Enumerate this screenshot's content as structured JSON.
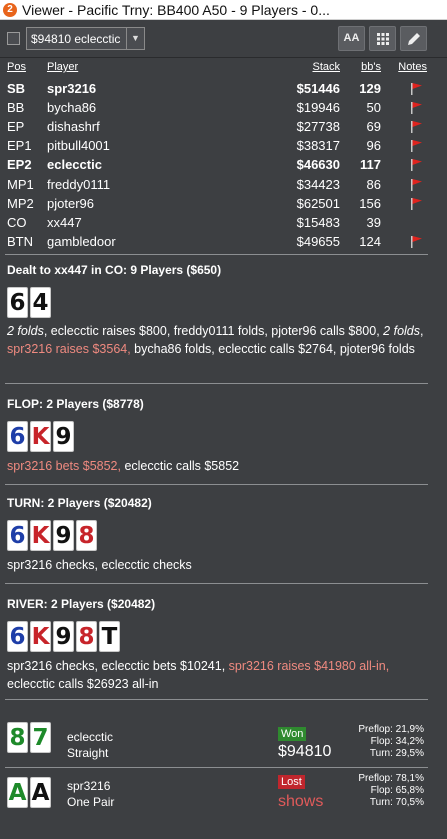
{
  "window": {
    "title": "Viewer - Pacific Trny: BB400 A50 - 9 Players - 0...",
    "app_icon_glyph": "2"
  },
  "toolbar": {
    "player_selected": "$94810 eclecctic",
    "font_button": "AA",
    "grid_button": "grid-icon",
    "edit_button": "pencil-icon"
  },
  "seats": {
    "headers": {
      "pos": "Pos",
      "player": "Player",
      "stack": "Stack",
      "bbs": "bb's",
      "notes": "Notes"
    },
    "rows": [
      {
        "pos": "SB",
        "player": "spr3216",
        "stack": "$51446",
        "bbs": "129",
        "flag": true,
        "bold": true
      },
      {
        "pos": "BB",
        "player": "bycha86",
        "stack": "$19946",
        "bbs": "50",
        "flag": true,
        "bold": false
      },
      {
        "pos": "EP",
        "player": "dishashrf",
        "stack": "$27738",
        "bbs": "69",
        "flag": true,
        "bold": false
      },
      {
        "pos": "EP1",
        "player": "pitbull4001",
        "stack": "$38317",
        "bbs": "96",
        "flag": true,
        "bold": false
      },
      {
        "pos": "EP2",
        "player": "eclecctic",
        "stack": "$46630",
        "bbs": "117",
        "flag": true,
        "bold": true
      },
      {
        "pos": "MP1",
        "player": "freddy0111",
        "stack": "$34423",
        "bbs": "86",
        "flag": true,
        "bold": false
      },
      {
        "pos": "MP2",
        "player": "pjoter96",
        "stack": "$62501",
        "bbs": "156",
        "flag": true,
        "bold": false
      },
      {
        "pos": "CO",
        "player": "xx447",
        "stack": "$15483",
        "bbs": "39",
        "flag": false,
        "bold": false
      },
      {
        "pos": "BTN",
        "player": "gambledoor",
        "stack": "$49655",
        "bbs": "124",
        "flag": true,
        "bold": false
      }
    ]
  },
  "preflop": {
    "heading": "Dealt to xx447 in CO: 9 Players ($650)",
    "cards": [
      {
        "rank": "6",
        "suit": "s"
      },
      {
        "rank": "4",
        "suit": "s"
      }
    ],
    "actions": [
      {
        "text": "2 folds",
        "style": "it"
      },
      {
        "text": ", eclecctic raises $800, freddy0111 folds, pjoter96 calls $800, ",
        "style": ""
      },
      {
        "text": "2 folds",
        "style": "it"
      },
      {
        "text": ", ",
        "style": ""
      },
      {
        "text": "spr3216 raises $3564,",
        "style": "hl"
      },
      {
        "text": " bycha86 folds, eclecctic calls $2764, pjoter96 folds",
        "style": ""
      }
    ]
  },
  "flop": {
    "heading": "FLOP: 2 Players ($8778)",
    "cards": [
      {
        "rank": "6",
        "suit": "d"
      },
      {
        "rank": "K",
        "suit": "h"
      },
      {
        "rank": "9",
        "suit": "s"
      }
    ],
    "actions": [
      {
        "text": "spr3216 bets $5852,",
        "style": "hl"
      },
      {
        "text": " eclecctic calls $5852",
        "style": ""
      }
    ]
  },
  "turn": {
    "heading": "TURN: 2 Players ($20482)",
    "cards": [
      {
        "rank": "6",
        "suit": "d"
      },
      {
        "rank": "K",
        "suit": "h"
      },
      {
        "rank": "9",
        "suit": "s"
      },
      {
        "rank": "8",
        "suit": "h"
      }
    ],
    "actions": [
      {
        "text": "spr3216 checks, eclecctic checks",
        "style": ""
      }
    ]
  },
  "river": {
    "heading": "RIVER: 2 Players ($20482)",
    "cards": [
      {
        "rank": "6",
        "suit": "d"
      },
      {
        "rank": "K",
        "suit": "h"
      },
      {
        "rank": "9",
        "suit": "s"
      },
      {
        "rank": "8",
        "suit": "h"
      },
      {
        "rank": "T",
        "suit": "s"
      }
    ],
    "actions": [
      {
        "text": "spr3216 checks, eclecctic bets $10241, ",
        "style": ""
      },
      {
        "text": "spr3216 raises $41980 all-in,",
        "style": "hl"
      },
      {
        "text": " eclecctic calls $26923 all-in",
        "style": ""
      }
    ]
  },
  "results": [
    {
      "player": "eclecctic",
      "hand": "Straight",
      "cards": [
        {
          "rank": "8",
          "suit": "c"
        },
        {
          "rank": "7",
          "suit": "c"
        }
      ],
      "badge": "Won",
      "badge_color": "#2f8a2f",
      "amount": "$94810",
      "amount_color": "#ffffff",
      "equity": {
        "preflop_label": "Preflop:",
        "preflop": "21,9%",
        "flop_label": "Flop:",
        "flop": "34,2%",
        "turn_label": "Turn:",
        "turn": "29,5%"
      }
    },
    {
      "player": "spr3216",
      "hand": "One Pair",
      "cards": [
        {
          "rank": "A",
          "suit": "c"
        },
        {
          "rank": "A",
          "suit": "s"
        }
      ],
      "badge": "Lost",
      "badge_color": "#c0262d",
      "amount": "shows",
      "amount_color": "#e05a5a",
      "equity": {
        "preflop_label": "Preflop:",
        "preflop": "78,1%",
        "flop_label": "Flop:",
        "flop": "65,8%",
        "turn_label": "Turn:",
        "turn": "70,5%"
      }
    }
  ]
}
